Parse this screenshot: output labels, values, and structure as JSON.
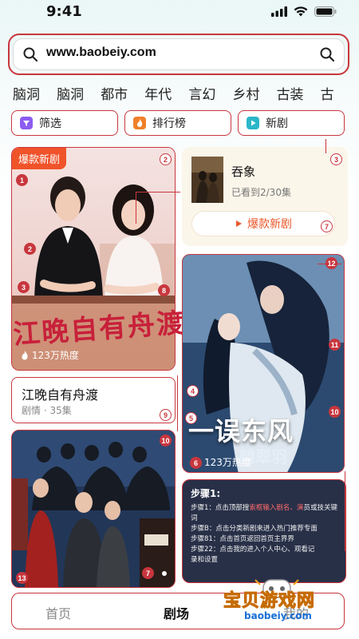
{
  "status": {
    "time": "9:41"
  },
  "search": {
    "url": "www.baobeiy.com"
  },
  "categories": [
    "脑洞",
    "脑洞",
    "都市",
    "年代",
    "言幻",
    "乡村",
    "古装",
    "古"
  ],
  "filters": [
    {
      "label": "筛选",
      "color": "#8d5cf0"
    },
    {
      "label": "排行榜",
      "color": "#f0802a"
    },
    {
      "label": "新剧",
      "color": "#2bb7c9"
    }
  ],
  "card1": {
    "badge": "爆款新剧",
    "poster_text": "江晚自有舟渡",
    "heat": "123万热度",
    "title": "江晚自有舟渡",
    "sub": "剧情 · 35集"
  },
  "watching": {
    "title": "吞象",
    "progress": "已看到2/30集",
    "button": "爆款新剧"
  },
  "card2": {
    "poster_line1": "一误东风",
    "poster_line2": "韓翠羽",
    "heat": "123万热度"
  },
  "steps": {
    "heading": "步骤1:",
    "lines": [
      {
        "prefix": "步骤1：点击顶部搜",
        "highlight": "索框输入剧名、演",
        "suffix": "员或技关键词"
      },
      {
        "prefix": "步骤B：点击分类新剧来进入热门推荐专面",
        "highlight": "",
        "suffix": ""
      },
      {
        "prefix": "步骤81：点击首页返回首页主界界",
        "highlight": "",
        "suffix": ""
      },
      {
        "prefix": "步骤22：点击我的进入个人中心、观看记",
        "highlight": "",
        "suffix": ""
      },
      {
        "prefix": "录和设置",
        "highlight": "",
        "suffix": ""
      }
    ]
  },
  "nav": {
    "home": "首页",
    "theater": "剧场",
    "mine": "我的"
  },
  "watermark": {
    "brand": "宝贝游戏网",
    "url": "baobeiy.com"
  },
  "markers": [
    "1",
    "2",
    "2",
    "3",
    "8",
    "4",
    "5",
    "9",
    "7",
    "12",
    "11",
    "10",
    "6",
    "10",
    "13",
    "7",
    "3"
  ]
}
